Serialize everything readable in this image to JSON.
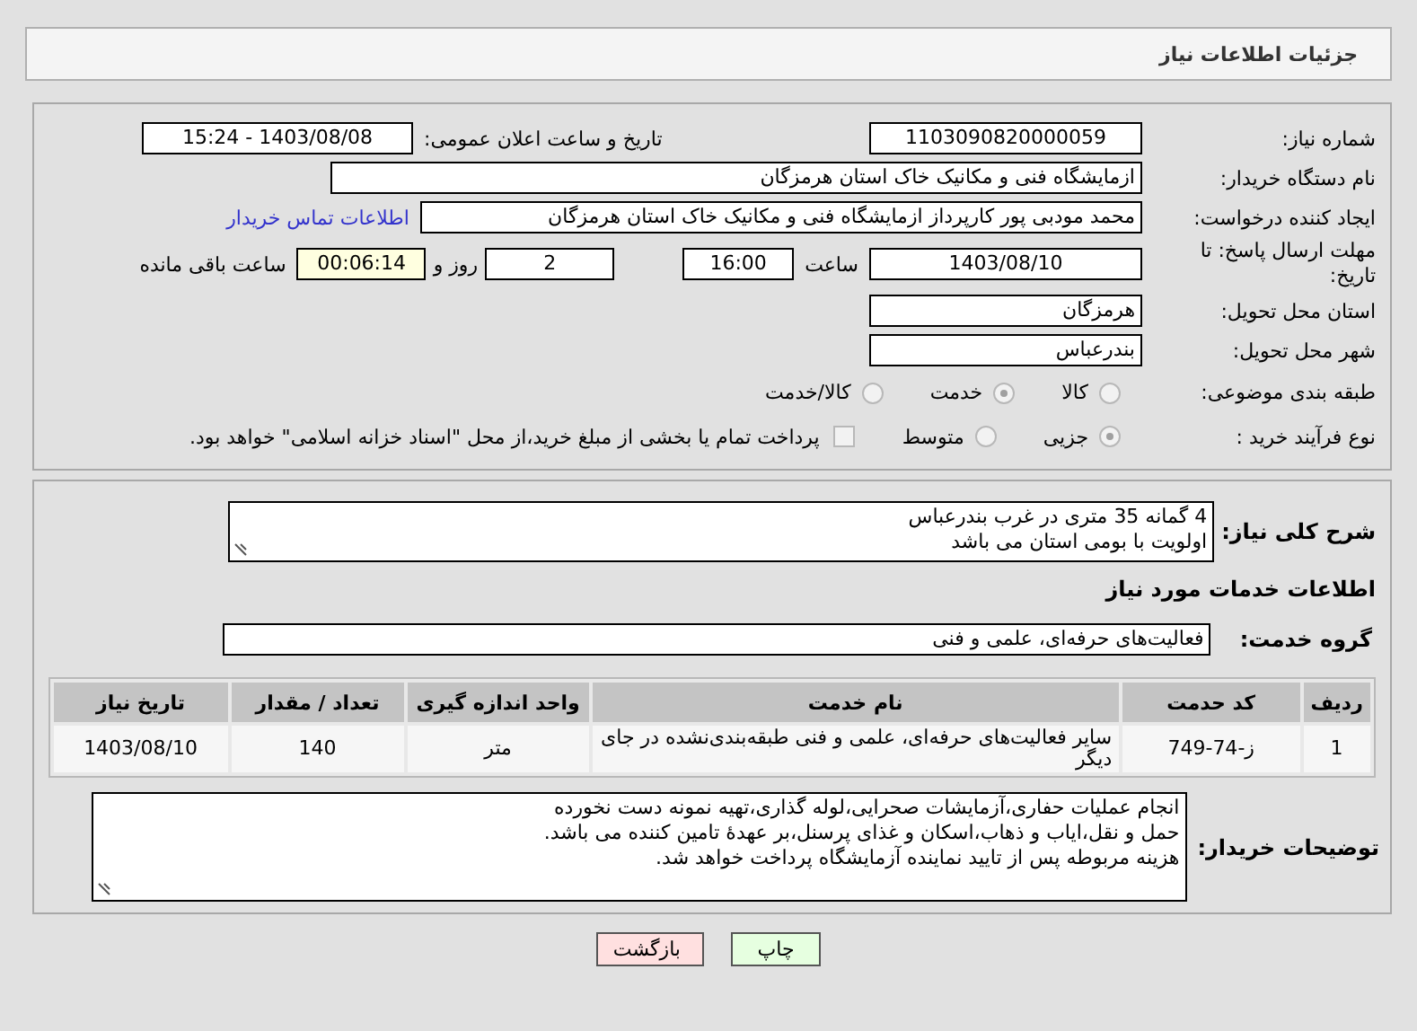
{
  "header": {
    "title": "جزئیات اطلاعات نیاز"
  },
  "details": {
    "need_number": {
      "label": "شماره نیاز:",
      "value": "1103090820000059"
    },
    "announce": {
      "label": "تاریخ و ساعت اعلان عمومی:",
      "value": "1403/08/08 - 15:24"
    },
    "buyer": {
      "label": "نام دستگاه خریدار:",
      "value": "ازمایشگاه فنی و مکانیک خاک استان هرمزگان"
    },
    "creator": {
      "label": "ایجاد کننده درخواست:",
      "value": "محمد  مودبی پور کارپرداز ازمایشگاه فنی و مکانیک خاک استان هرمزگان",
      "link": "اطلاعات تماس خریدار"
    },
    "deadline": {
      "label": "مهلت ارسال پاسخ: تا تاریخ:",
      "date": "1403/08/10",
      "time_label": "ساعت",
      "time": "16:00",
      "days": "2",
      "days_label": "روز و",
      "remaining": "00:06:14",
      "remaining_label": "ساعت باقی مانده"
    },
    "province": {
      "label": "استان محل تحویل:",
      "value": "هرمزگان"
    },
    "city": {
      "label": "شهر محل تحویل:",
      "value": "بندرعباس"
    },
    "category": {
      "label": "طبقه بندی موضوعی:",
      "options": [
        {
          "label": "کالا",
          "selected": false
        },
        {
          "label": "خدمت",
          "selected": true
        },
        {
          "label": "کالا/خدمت",
          "selected": false
        }
      ]
    },
    "process": {
      "label": "نوع فرآیند خرید :",
      "options": [
        {
          "label": "جزیی",
          "selected": true
        },
        {
          "label": "متوسط",
          "selected": false
        }
      ],
      "treasury": {
        "checked": false,
        "label": "پرداخت تمام یا بخشی از مبلغ خرید،از محل \"اسناد خزانه اسلامی\" خواهد بود."
      }
    }
  },
  "summary": {
    "label": "شرح کلی نیاز:",
    "value": "4 گمانه 35 متری در غرب بندرعباس\nاولویت با بومی استان می باشد"
  },
  "services": {
    "title": "اطلاعات خدمات مورد نیاز",
    "group_label": "گروه خدمت:",
    "group": "فعالیت‌های حرفه‌ای، علمی و فنی",
    "table": {
      "columns": [
        "ردیف",
        "کد حدمت",
        "نام خدمت",
        "واحد اندازه گیری",
        "تعداد / مقدار",
        "تاریخ نیاز"
      ],
      "rows": [
        [
          "1",
          "ز-74-749",
          "سایر فعالیت‌های حرفه‌ای، علمی و فنی طبقه‌بندی‌نشده در جای دیگر",
          "متر",
          "140",
          "1403/08/10"
        ]
      ]
    }
  },
  "notes": {
    "label": "توضیحات خریدار:",
    "value": "انجام عملیات حفاری،آزمایشات صحرایی،لوله گذاری،تهیه نمونه دست نخورده\nحمل و نقل،ایاب و ذهاب،اسکان و غذای پرسنل،بر عهدهٔ تامین کننده می باشد.\nهزینه مربوطه پس از تایید نماینده آزمایشگاه پرداخت خواهد شد."
  },
  "buttons": [
    {
      "label": "چاپ",
      "kind": "print"
    },
    {
      "label": "بازگشت",
      "kind": "back"
    }
  ]
}
